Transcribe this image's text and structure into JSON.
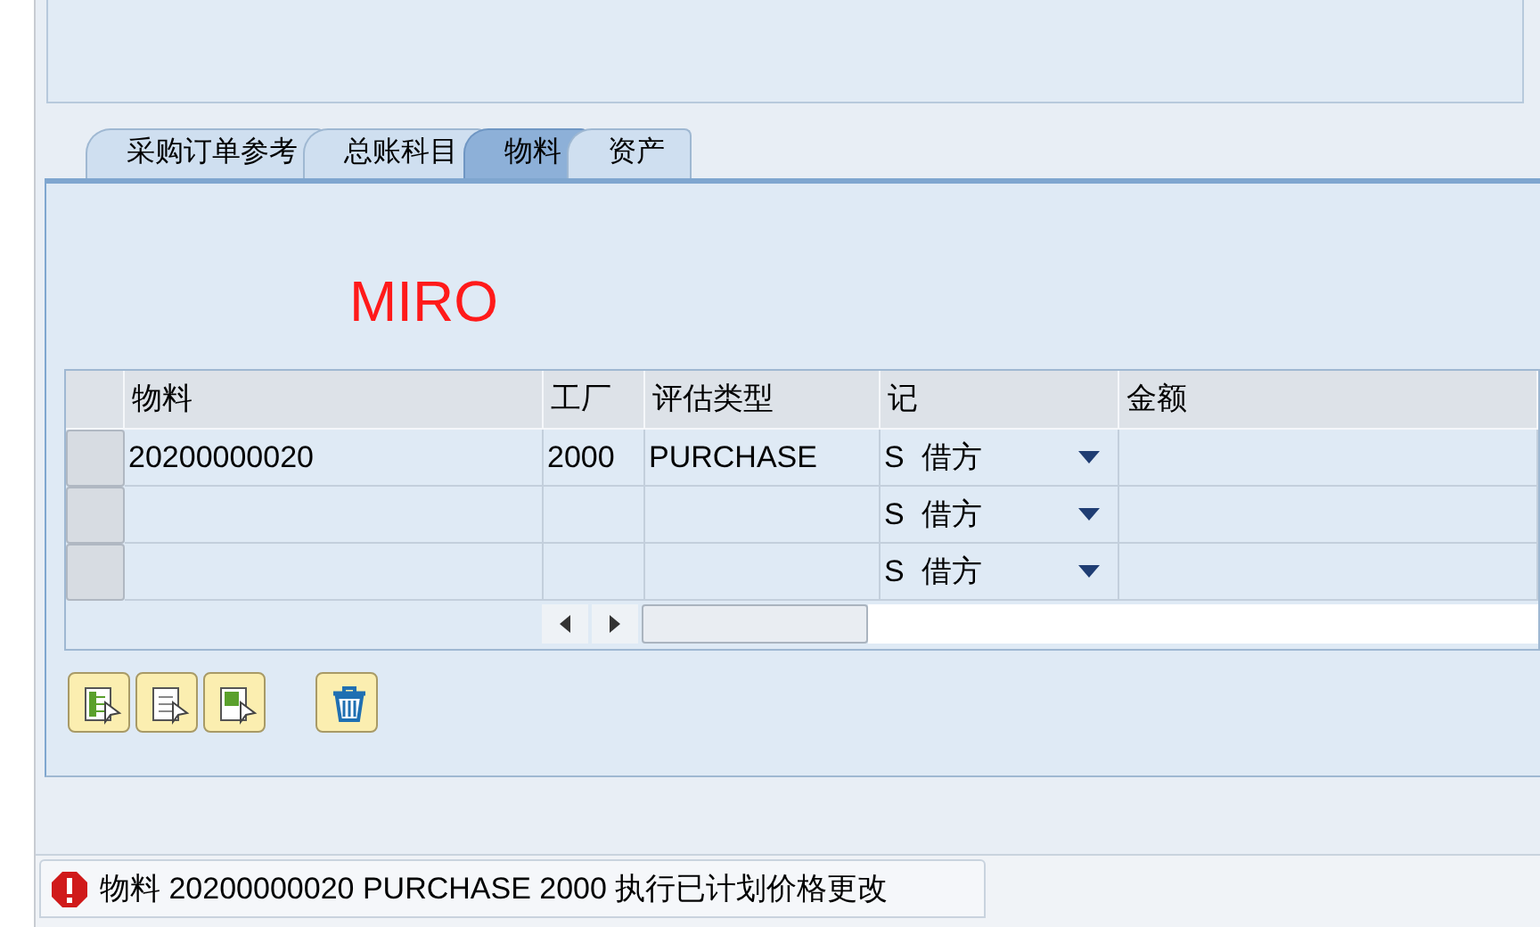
{
  "tabs": [
    {
      "label": "采购订单参考",
      "selected": false
    },
    {
      "label": "总账科目",
      "selected": false
    },
    {
      "label": "物料",
      "selected": true
    },
    {
      "label": "资产",
      "selected": false
    }
  ],
  "heading": "MIRO",
  "table": {
    "columns": [
      {
        "label": "物料",
        "kind": "text"
      },
      {
        "label": "工厂",
        "kind": "text"
      },
      {
        "label": "评估类型",
        "kind": "text"
      },
      {
        "label": "记",
        "kind": "dropdown"
      },
      {
        "label": "金额",
        "kind": "text"
      }
    ],
    "rows": [
      {
        "cells": [
          "20200000020",
          "2000",
          "PURCHASE",
          "S  借方",
          ""
        ]
      },
      {
        "cells": [
          "",
          "",
          "",
          "S  借方",
          ""
        ]
      },
      {
        "cells": [
          "",
          "",
          "",
          "S  借方",
          ""
        ]
      }
    ]
  },
  "buttons": [
    {
      "kind": "select-all"
    },
    {
      "kind": "deselect-all"
    },
    {
      "kind": "select-block"
    },
    {
      "kind": "delete"
    }
  ],
  "status": {
    "kind": "error",
    "text": "物料 20200000020 PURCHASE 2000 执行已计划价格更改"
  }
}
